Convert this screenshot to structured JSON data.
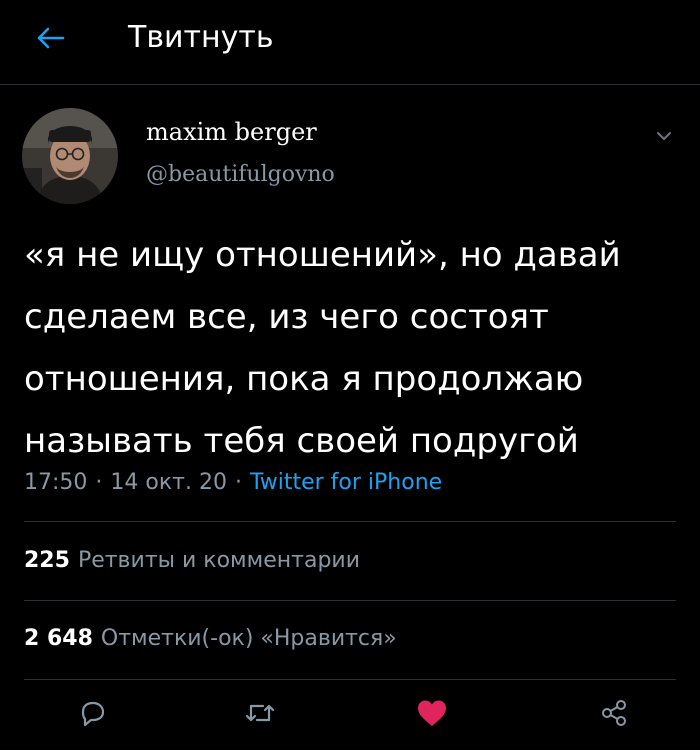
{
  "header": {
    "title": "Твитнуть"
  },
  "tweet": {
    "author_name": "maxim berger",
    "author_handle": "@beautifulgovno",
    "text": "«я не ищу отношений», но давай сделаем все, из чего состоят отношения, пока я продолжаю называть тебя своей подругой",
    "time": "17:50",
    "date": "14 окт. 20",
    "separator": "·",
    "source": "Twitter for iPhone"
  },
  "stats": {
    "retweets_count": "225",
    "retweets_label": "Ретвиты и комментарии",
    "likes_count": "2 648",
    "likes_label": "Отметки(-ок) «Нравится»"
  },
  "actions": [
    "reply-icon",
    "retweet-icon",
    "like-icon",
    "share-icon"
  ],
  "colors": {
    "background": "#000000",
    "accent": "#1da1f2",
    "secondary_text": "#8899a6",
    "divider": "#2a2f33",
    "like": "#e0245e"
  }
}
